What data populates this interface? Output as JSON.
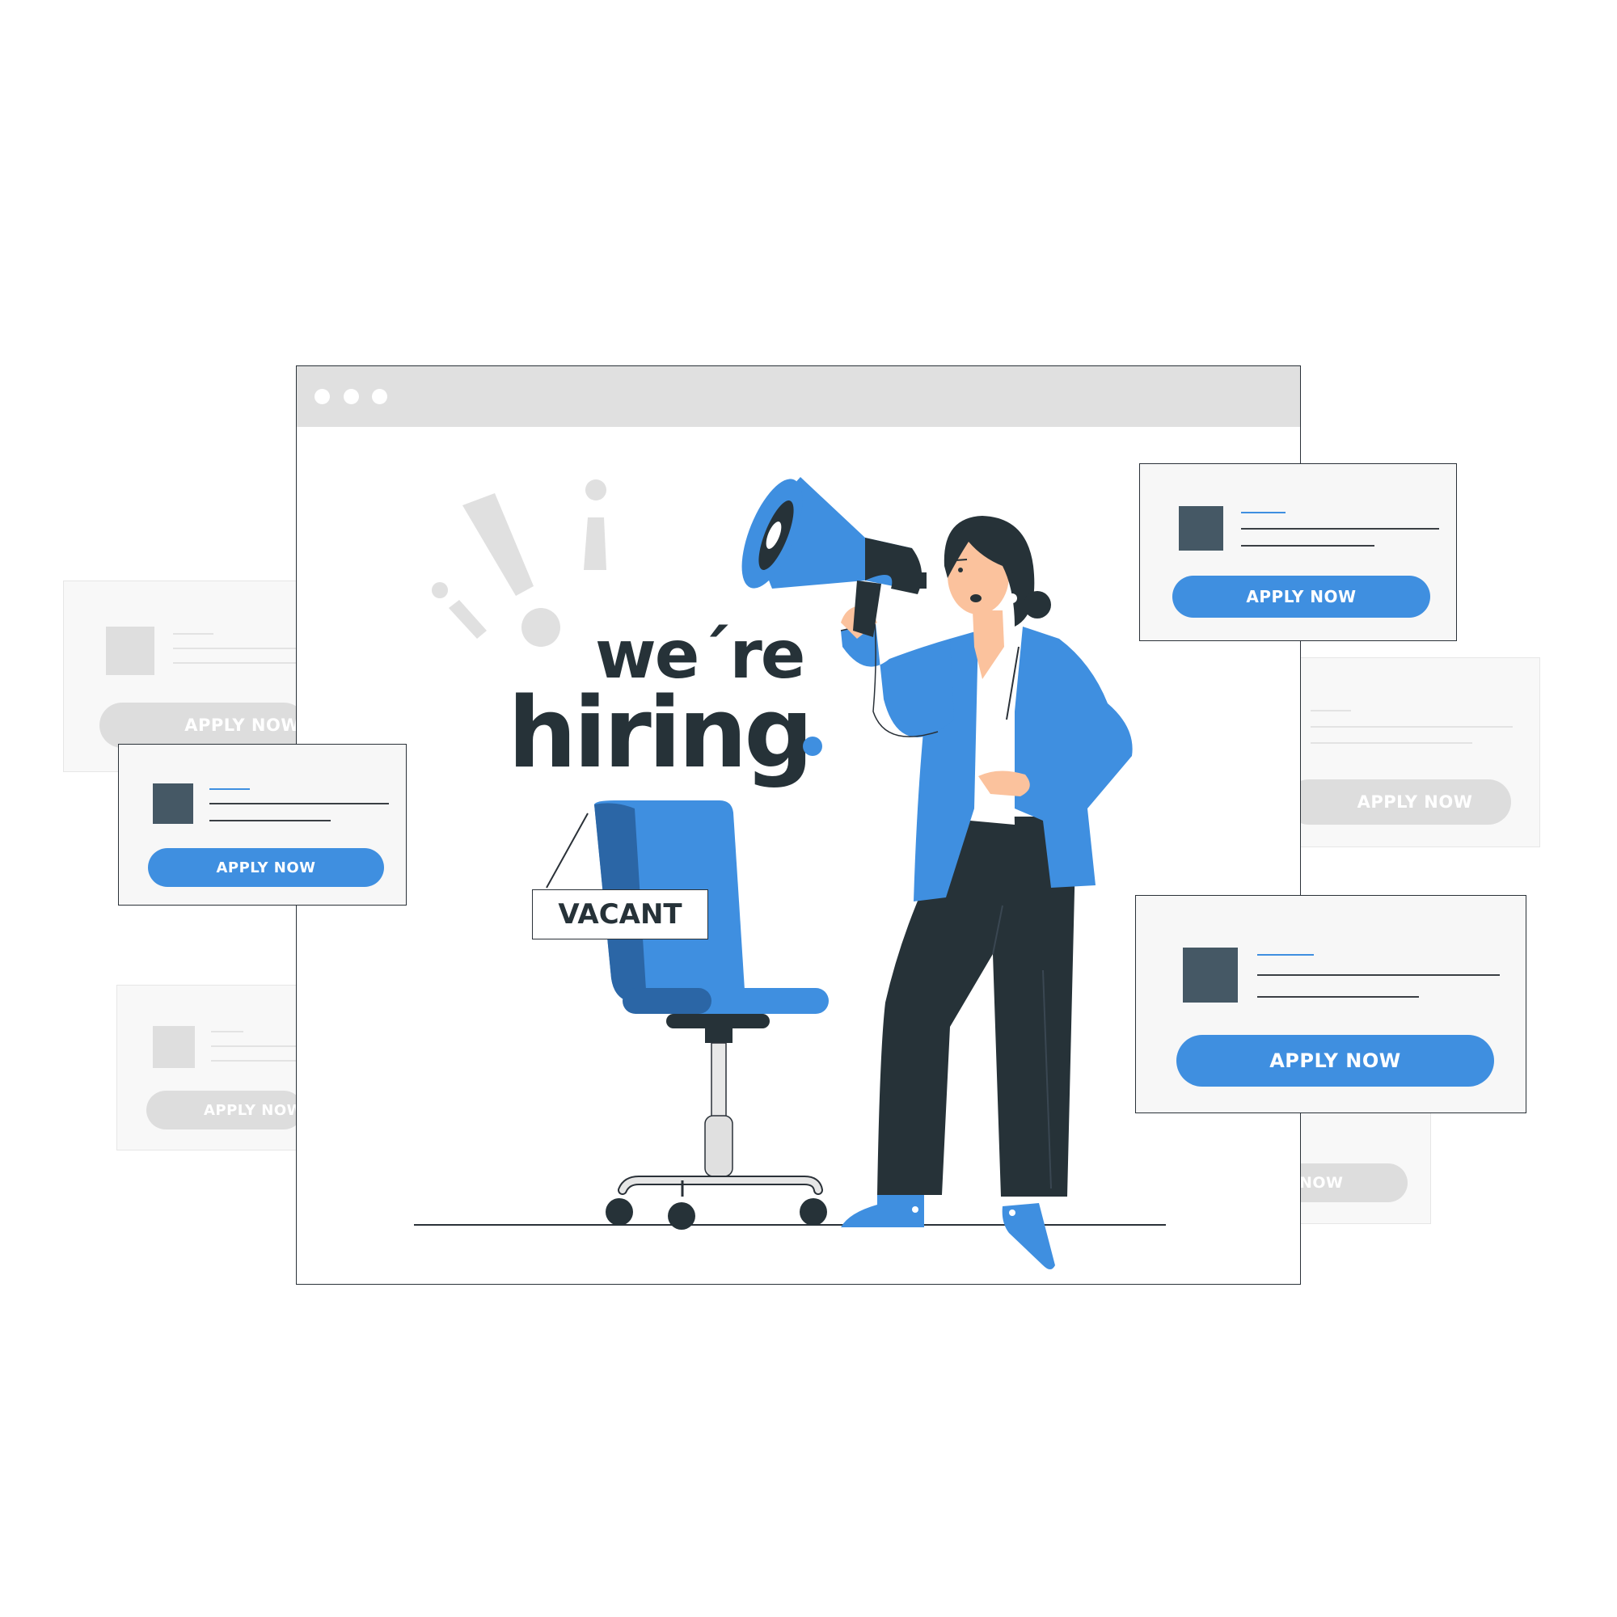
{
  "browser": {
    "window_dots": [
      "",
      "",
      ""
    ]
  },
  "headline": {
    "line1": "we´re",
    "line2": "hiring"
  },
  "chair_sign": "VACANT",
  "job_cards": [
    {
      "apply_label": "APPLY NOW"
    },
    {
      "apply_label": "APPLY NOW"
    },
    {
      "apply_label": "APPLY NOW"
    },
    {
      "apply_label": "APPLY NOW"
    },
    {
      "apply_label": "APPLY NOW"
    },
    {
      "apply_label": "APPLY NOW"
    },
    {
      "apply_label": "NOW"
    }
  ],
  "colors": {
    "accent": "#3f8fe0",
    "dark": "#263238",
    "faded": "#dddddd",
    "skin": "#fbc29d"
  }
}
